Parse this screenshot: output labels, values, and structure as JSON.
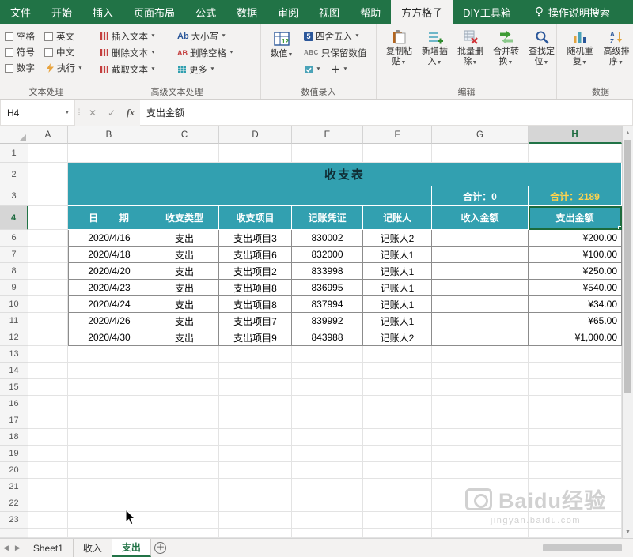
{
  "ribbon": {
    "tabs": [
      {
        "label": "文件"
      },
      {
        "label": "开始"
      },
      {
        "label": "插入"
      },
      {
        "label": "页面布局"
      },
      {
        "label": "公式"
      },
      {
        "label": "数据"
      },
      {
        "label": "审阅"
      },
      {
        "label": "视图"
      },
      {
        "label": "帮助"
      },
      {
        "label": "方方格子",
        "active": true
      },
      {
        "label": "DIY工具箱"
      }
    ],
    "tellme": "操作说明搜索",
    "text_processing": {
      "label": "文本处理",
      "checkboxes": [
        "空格",
        "英文",
        "符号",
        "中文",
        "数字"
      ],
      "execute": "执行"
    },
    "adv_text": {
      "label": "高级文本处理",
      "insert_text": "插入文本",
      "delete_text": "删除文本",
      "extract_text": "截取文本",
      "case": "大小写",
      "delete_space": "删除空格",
      "more": "更多"
    },
    "numeric_entry": {
      "label": "数值录入",
      "big": "数值",
      "rounding": "四舍五入",
      "keep_numeric": "只保留数值"
    },
    "edit": {
      "label": "编辑",
      "buttons": [
        "复制粘贴",
        "新增插入",
        "批量删除",
        "合并转换",
        "查找定位"
      ]
    },
    "data_group": {
      "label": "数据",
      "buttons": [
        "随机重复",
        "高级排序"
      ]
    }
  },
  "formula_bar": {
    "name_box": "H4",
    "formula": "支出金额"
  },
  "grid": {
    "columns": [
      "A",
      "B",
      "C",
      "D",
      "E",
      "F",
      "G",
      "H"
    ],
    "row_labels": [
      "1",
      "2",
      "3",
      "4",
      "6",
      "7",
      "8",
      "9",
      "10",
      "11",
      "12",
      "13",
      "14",
      "15",
      "16",
      "17",
      "18",
      "19",
      "20",
      "21",
      "22",
      "23"
    ],
    "selected_cell": "H4"
  },
  "table": {
    "title": "收支表",
    "totals": {
      "income": "合计：0",
      "expense": "合计：2189"
    },
    "headers": [
      "日        期",
      "收支类型",
      "收支项目",
      "记账凭证",
      "记账人",
      "收入金额",
      "支出金额"
    ],
    "rows": [
      [
        "2020/4/16",
        "支出",
        "支出项目3",
        "830002",
        "记账人2",
        "",
        "¥200.00"
      ],
      [
        "2020/4/18",
        "支出",
        "支出项目6",
        "832000",
        "记账人1",
        "",
        "¥100.00"
      ],
      [
        "2020/4/20",
        "支出",
        "支出项目2",
        "833998",
        "记账人1",
        "",
        "¥250.00"
      ],
      [
        "2020/4/23",
        "支出",
        "支出项目8",
        "836995",
        "记账人1",
        "",
        "¥540.00"
      ],
      [
        "2020/4/24",
        "支出",
        "支出项目8",
        "837994",
        "记账人1",
        "",
        "¥34.00"
      ],
      [
        "2020/4/26",
        "支出",
        "支出项目7",
        "839992",
        "记账人1",
        "",
        "¥65.00"
      ],
      [
        "2020/4/30",
        "支出",
        "支出项目9",
        "843988",
        "记账人2",
        "",
        "¥1,000.00"
      ]
    ]
  },
  "sheet_bar": {
    "tabs": [
      "Sheet1",
      "收入",
      "支出"
    ],
    "active": "支出"
  },
  "icons": {
    "dropdown": "▼",
    "case_ab": "Ab",
    "delspace_ab": "AB",
    "abc": "ABC",
    "plus": "＋",
    "fx": "fx",
    "cancel": "✕",
    "enter": "✓",
    "tabs_prev": "◀",
    "tabs_next": "▶",
    "new_sheet": "＋",
    "up_arrow": "▲",
    "down_arrow": "▼"
  },
  "colors": {
    "ribbon_green": "#217346",
    "table_teal": "#32a0b0",
    "total_highlight": "#ffd34d",
    "active_sheet_green": "#217346"
  },
  "watermark": {
    "brand": "Baidu",
    "suffix": "经验",
    "url": "jingyan.baidu.com"
  }
}
